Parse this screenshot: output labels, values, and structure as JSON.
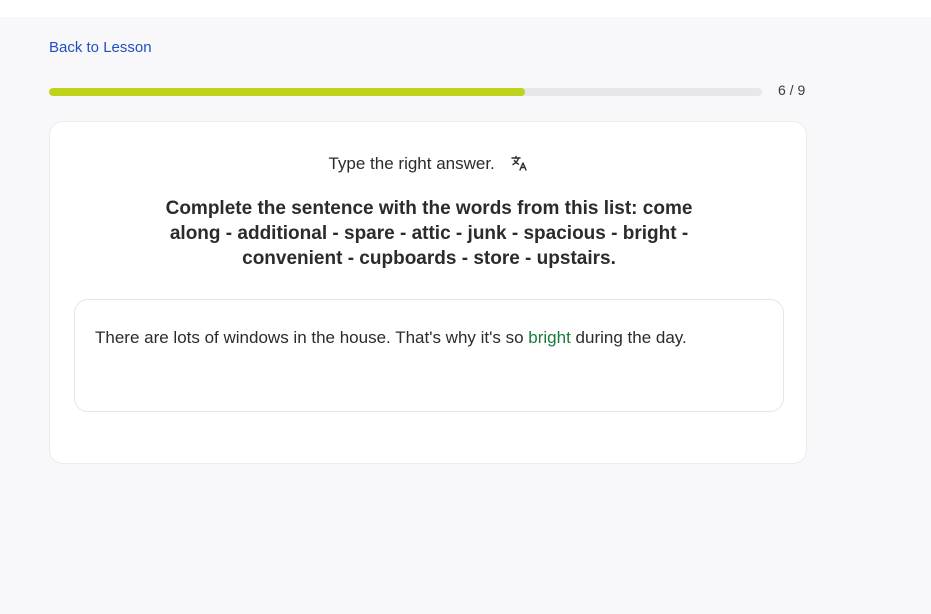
{
  "nav": {
    "back_label": "Back to Lesson"
  },
  "progress": {
    "current": 6,
    "total": 9,
    "fraction": 0.667,
    "label": "6 / 9",
    "color": "#bfd21c"
  },
  "question": {
    "instruction": "Type the right answer.",
    "instruction_icon": "translate-icon",
    "prompt": "Complete the sentence with the words from this list: come along - additional - spare - attic - junk - spacious - bright - convenient - cupboards - store - upstairs.",
    "sentence_before": "There are lots of windows in the house. That's why it's so ",
    "answer": "bright",
    "sentence_after": " during the day.",
    "answer_color": "#1a7a3c"
  }
}
